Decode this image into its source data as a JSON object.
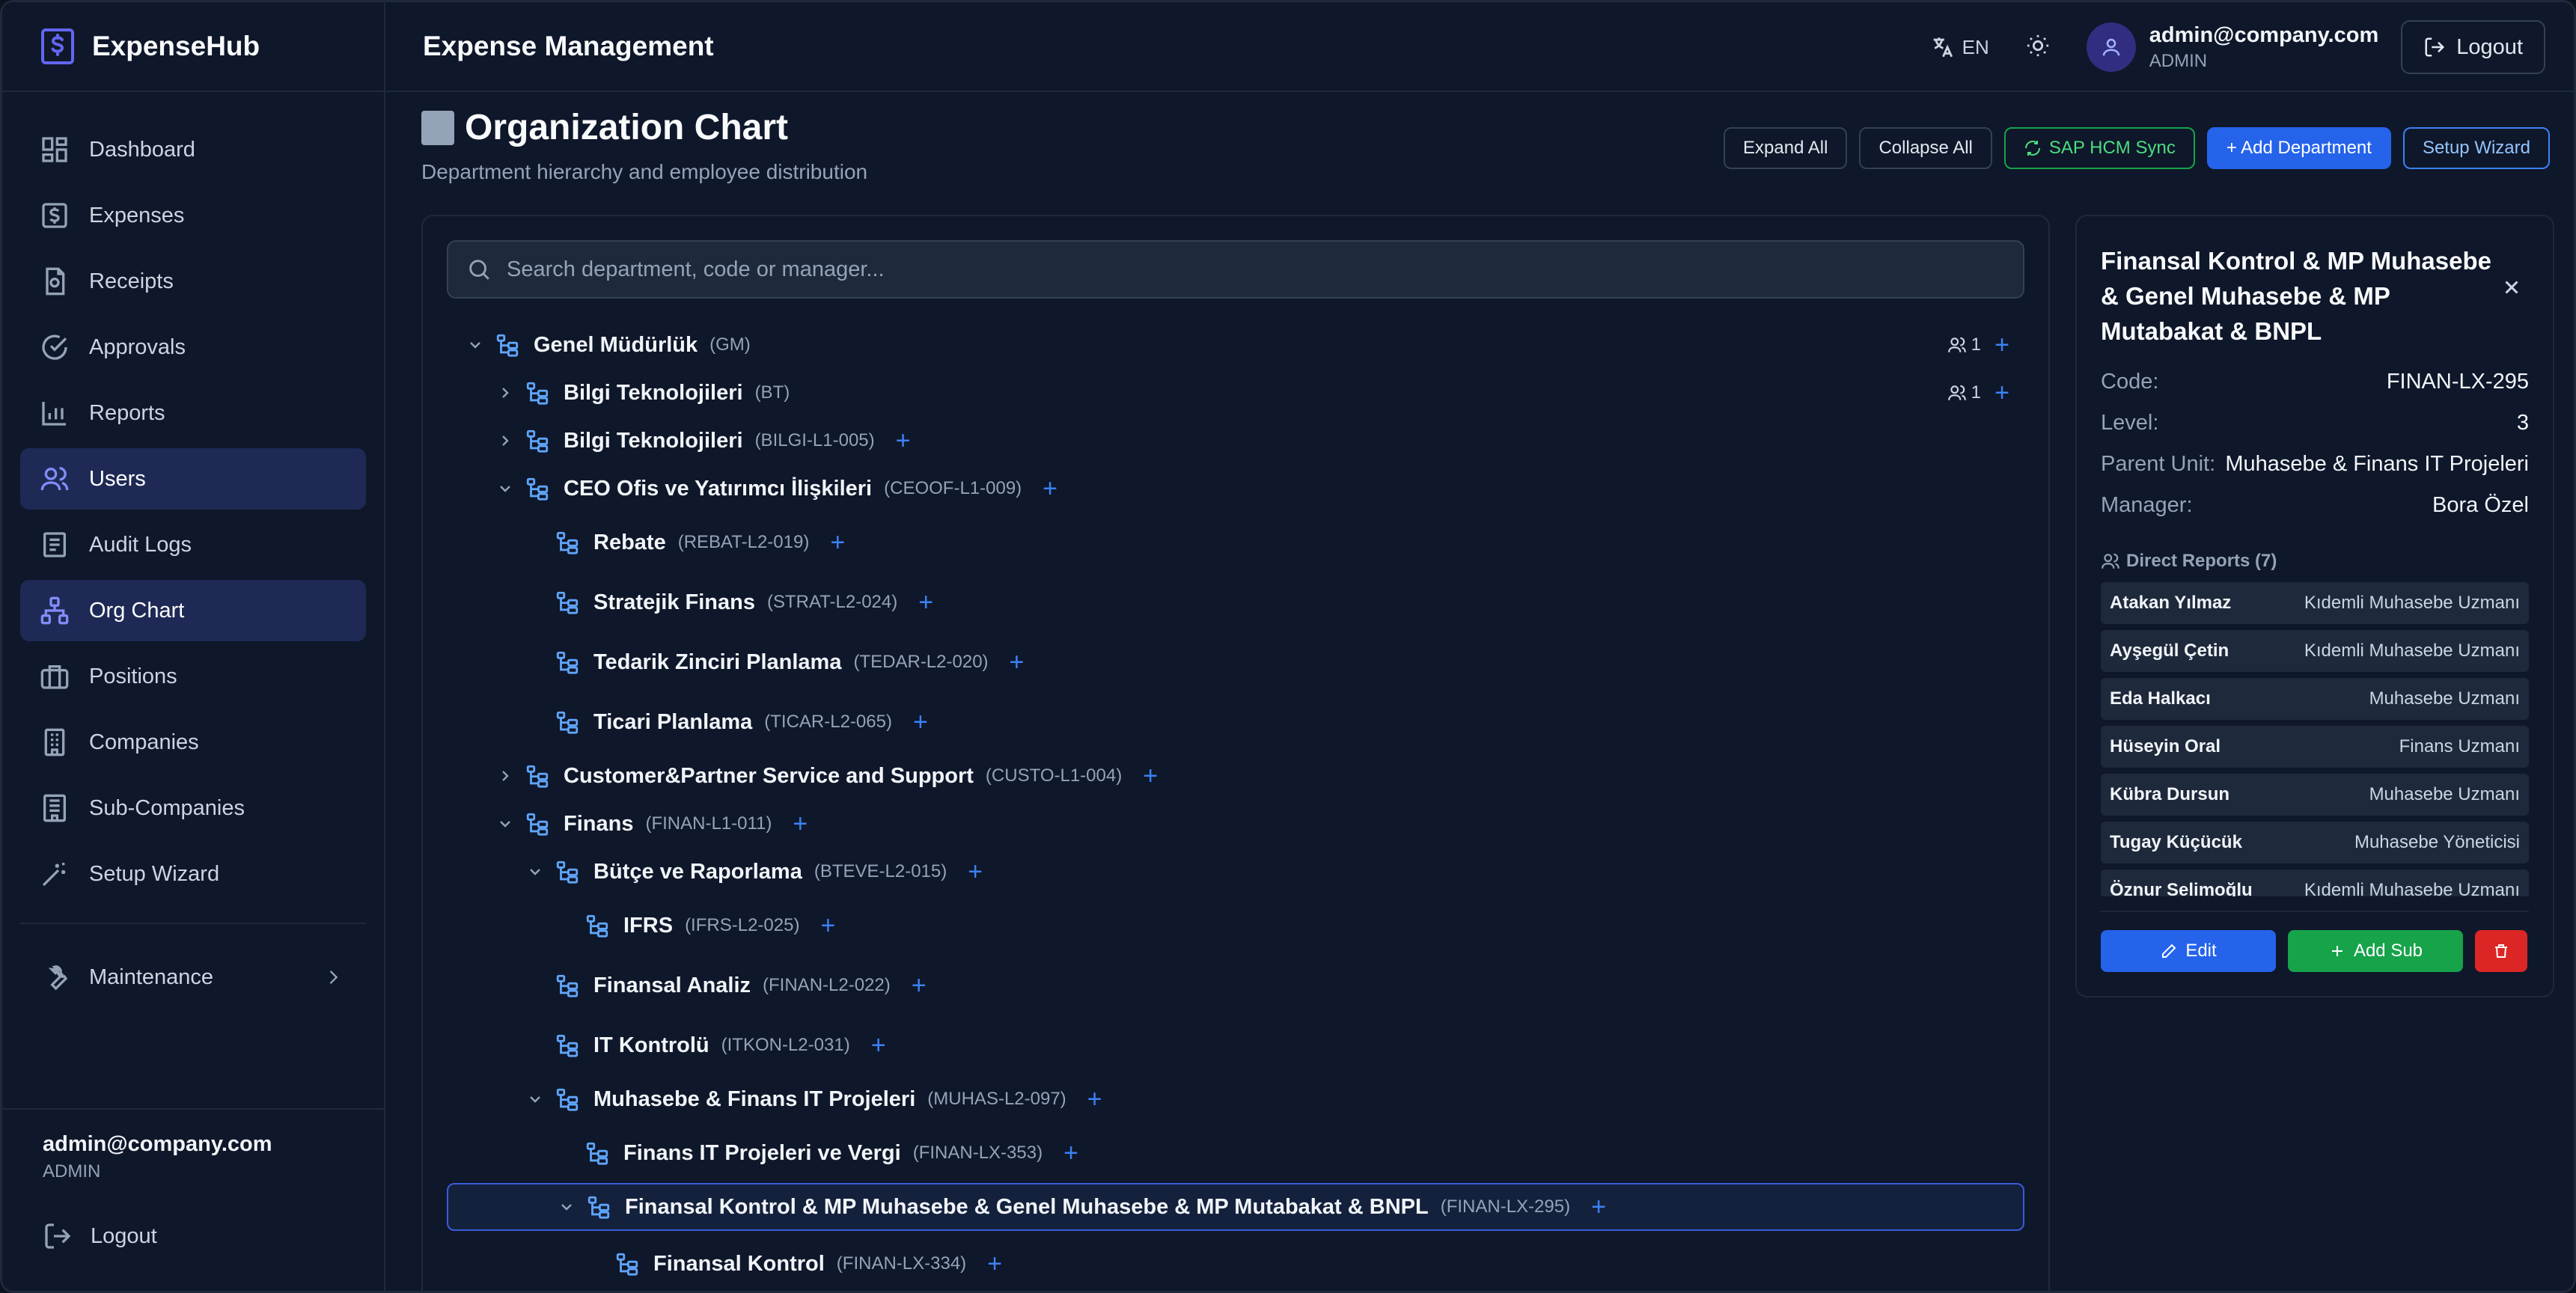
{
  "brand": {
    "name": "ExpenseHub"
  },
  "sidebar": {
    "items": [
      {
        "label": "Dashboard"
      },
      {
        "label": "Expenses"
      },
      {
        "label": "Receipts"
      },
      {
        "label": "Approvals"
      },
      {
        "label": "Reports"
      },
      {
        "label": "Users"
      },
      {
        "label": "Audit Logs"
      },
      {
        "label": "Org Chart"
      },
      {
        "label": "Positions"
      },
      {
        "label": "Companies"
      },
      {
        "label": "Sub-Companies"
      },
      {
        "label": "Setup Wizard"
      }
    ],
    "maintenance": "Maintenance",
    "footer": {
      "email": "admin@company.com",
      "role": "ADMIN",
      "logout": "Logout"
    }
  },
  "topbar": {
    "title": "Expense Management",
    "lang": "EN",
    "email": "admin@company.com",
    "role": "ADMIN",
    "logout": "Logout"
  },
  "page": {
    "title": "Organization Chart",
    "subtitle": "Department hierarchy and employee distribution",
    "actions": {
      "expand": "Expand All",
      "collapse": "Collapse All",
      "sync": "SAP HCM Sync",
      "add": "+ Add Department",
      "wizard": "Setup Wizard"
    }
  },
  "search": {
    "placeholder": "Search department, code or manager..."
  },
  "tree": [
    {
      "name": "Genel Müdürlük",
      "code": "(GM)",
      "count": "1"
    },
    {
      "name": "Bilgi Teknolojileri",
      "code": "(BT)",
      "count": "1"
    },
    {
      "name": "Bilgi Teknolojileri",
      "code": "(BILGI-L1-005)"
    },
    {
      "name": "CEO Ofis ve Yatırımcı İlişkileri",
      "code": "(CEOOF-L1-009)"
    },
    {
      "name": "Rebate",
      "code": "(REBAT-L2-019)"
    },
    {
      "name": "Stratejik Finans",
      "code": "(STRAT-L2-024)"
    },
    {
      "name": "Tedarik Zinciri Planlama",
      "code": "(TEDAR-L2-020)"
    },
    {
      "name": "Ticari Planlama",
      "code": "(TICAR-L2-065)"
    },
    {
      "name": "Customer&Partner Service and Support",
      "code": "(CUSTO-L1-004)"
    },
    {
      "name": "Finans",
      "code": "(FINAN-L1-011)"
    },
    {
      "name": "Bütçe ve Raporlama",
      "code": "(BTEVE-L2-015)"
    },
    {
      "name": "IFRS",
      "code": "(IFRS-L2-025)"
    },
    {
      "name": "Finansal Analiz",
      "code": "(FINAN-L2-022)"
    },
    {
      "name": "IT Kontrolü",
      "code": "(ITKON-L2-031)"
    },
    {
      "name": "Muhasebe & Finans IT Projeleri",
      "code": "(MUHAS-L2-097)"
    },
    {
      "name": "Finans IT Projeleri ve Vergi",
      "code": "(FINAN-LX-353)"
    },
    {
      "name": "Finansal Kontrol & MP Muhasebe & Genel Muhasebe & MP Mutabakat & BNPL",
      "code": "(FINAN-LX-295)"
    },
    {
      "name": "Finansal Kontrol",
      "code": "(FINAN-LX-334)"
    }
  ],
  "detail": {
    "title": "Finansal Kontrol & MP Muhasebe & Genel Muhasebe & MP Mutabakat & BNPL",
    "code_label": "Code:",
    "code": "FINAN-LX-295",
    "level_label": "Level:",
    "level": "3",
    "parent_label": "Parent Unit:",
    "parent": "Muhasebe & Finans IT Projeleri",
    "manager_label": "Manager:",
    "manager": "Bora Özel",
    "reports_label": "Direct Reports (7)",
    "reports": [
      {
        "name": "Atakan Yılmaz",
        "title": "Kıdemli Muhasebe Uzmanı"
      },
      {
        "name": "Ayşegül Çetin",
        "title": "Kıdemli Muhasebe Uzmanı"
      },
      {
        "name": "Eda Halkacı",
        "title": "Muhasebe Uzmanı"
      },
      {
        "name": "Hüseyin Oral",
        "title": "Finans Uzmanı"
      },
      {
        "name": "Kübra Dursun",
        "title": "Muhasebe Uzmanı"
      },
      {
        "name": "Tugay Küçücük",
        "title": "Muhasebe Yöneticisi"
      },
      {
        "name": "Öznur Selimoğlu",
        "title": "Kıdemli Muhasebe Uzmanı"
      }
    ],
    "edit": "Edit",
    "add_sub": "Add Sub"
  },
  "colors": {
    "accent": "#2563eb",
    "success": "#16a34a",
    "danger": "#dc2626",
    "bg": "#0f172a"
  }
}
